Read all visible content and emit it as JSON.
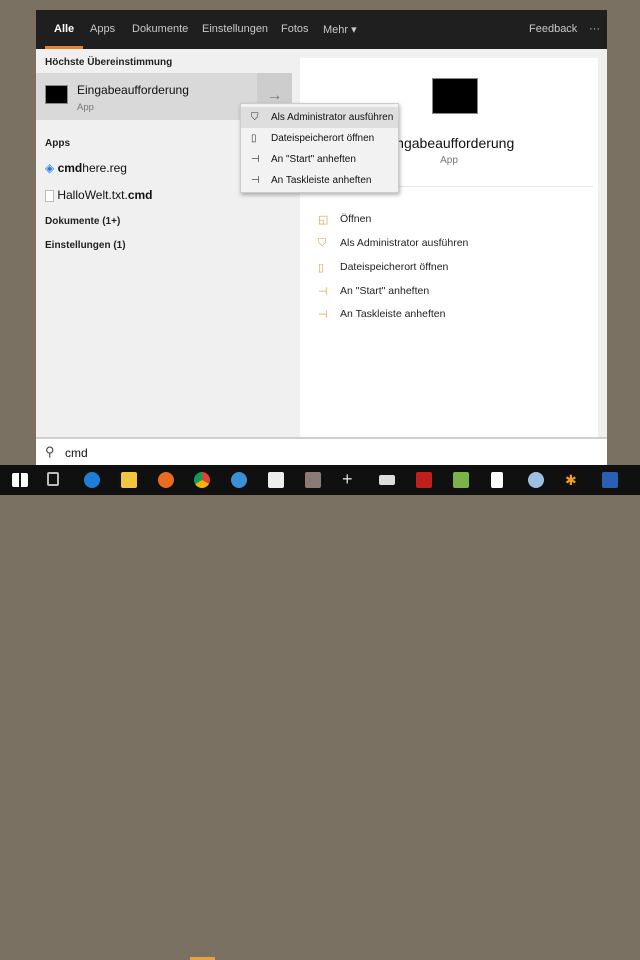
{
  "tabs": [
    {
      "label": "Alle"
    },
    {
      "label": "Apps"
    },
    {
      "label": "Dokumente"
    },
    {
      "label": "Einstellungen"
    },
    {
      "label": "Fotos"
    },
    {
      "label": "Mehr ▾"
    }
  ],
  "feedback": "Feedback",
  "more": "···",
  "results": {
    "best_header": "Höchste Übereinstimmung",
    "best": {
      "title": "Eingabeaufforderung",
      "subtitle": "App"
    },
    "apps_header": "Apps",
    "apps": [
      {
        "name_bold": "cmd",
        "name_rest": "here.reg"
      },
      {
        "name_pre": "HalloWelt.txt.",
        "name_bold": "cmd"
      }
    ],
    "docs_header": "Dokumente (1+)",
    "settings_header": "Einstellungen (1)"
  },
  "context_menu": [
    "Als Administrator ausführen",
    "Dateispeicherort öffnen",
    "An \"Start\" anheften",
    "An Taskleiste anheften"
  ],
  "detail": {
    "title": "Eingabeaufforderung",
    "subtitle": "App",
    "actions": [
      "Öffnen",
      "Als Administrator ausführen",
      "Dateispeicherort öffnen",
      "An \"Start\" anheften",
      "An Taskleiste anheften"
    ]
  },
  "search": {
    "value": "cmd"
  },
  "taskbar": [
    "start",
    "task-view",
    "edge",
    "explorer",
    "firefox",
    "chrome",
    "thunderbird",
    "mail",
    "app",
    "plus",
    "app2",
    "app3",
    "app4",
    "notepad",
    "paint",
    "app5",
    "word"
  ]
}
